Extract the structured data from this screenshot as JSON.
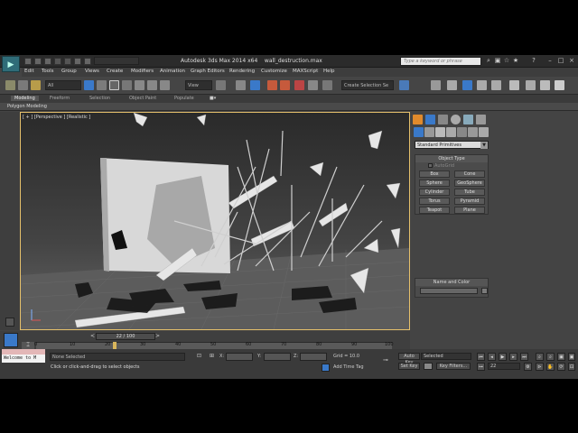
{
  "window": {
    "title": "Autodesk 3ds Max  2014 x64",
    "filename": "wall_destruction.max",
    "search_placeholder": "Type a keyword or phrase",
    "workspace_filter": "All",
    "view_select": "View",
    "named_selection": "Create Selection Se"
  },
  "menu": [
    "Edit",
    "Tools",
    "Group",
    "Views",
    "Create",
    "Modifiers",
    "Animation",
    "Graph Editors",
    "Rendering",
    "Customize",
    "MAXScript",
    "Help"
  ],
  "ribbon": {
    "tabs": [
      "Modeling",
      "Freeform",
      "Selection",
      "Object Paint",
      "Populate"
    ],
    "active": "Modeling",
    "sub_label": "Polygon Modeling"
  },
  "viewport": {
    "label": "[ + ] [Perspective ] [Realistic ]"
  },
  "command_panel": {
    "category_dropdown": "Standard Primitives",
    "object_type_title": "Object Type",
    "autogrid_label": "AutoGrid",
    "buttons": [
      "Box",
      "Cone",
      "Sphere",
      "GeoSphere",
      "Cylinder",
      "Tube",
      "Torus",
      "Pyramid",
      "Teapot",
      "Plane"
    ],
    "name_color_title": "Name and Color"
  },
  "timeline": {
    "frame_display": "22 / 100",
    "current_frame": 22,
    "total_frames": 100,
    "ticks": [
      "0",
      "10",
      "20",
      "30",
      "40",
      "50",
      "60",
      "70",
      "80",
      "90",
      "100"
    ]
  },
  "status": {
    "listener_text": "Welcome to M",
    "selection_text": "None Selected",
    "prompt_text": "Click or click-and-drag to select objects",
    "x_label": "X:",
    "y_label": "Y:",
    "z_label": "Z:",
    "grid_text": "Grid = 10.0",
    "add_time_tag": "Add Time Tag",
    "auto_key": "Auto Key",
    "selected_dropdown": "Selected",
    "set_key": "Set Key",
    "key_filters": "Key Filters...",
    "frame_field": "22"
  }
}
